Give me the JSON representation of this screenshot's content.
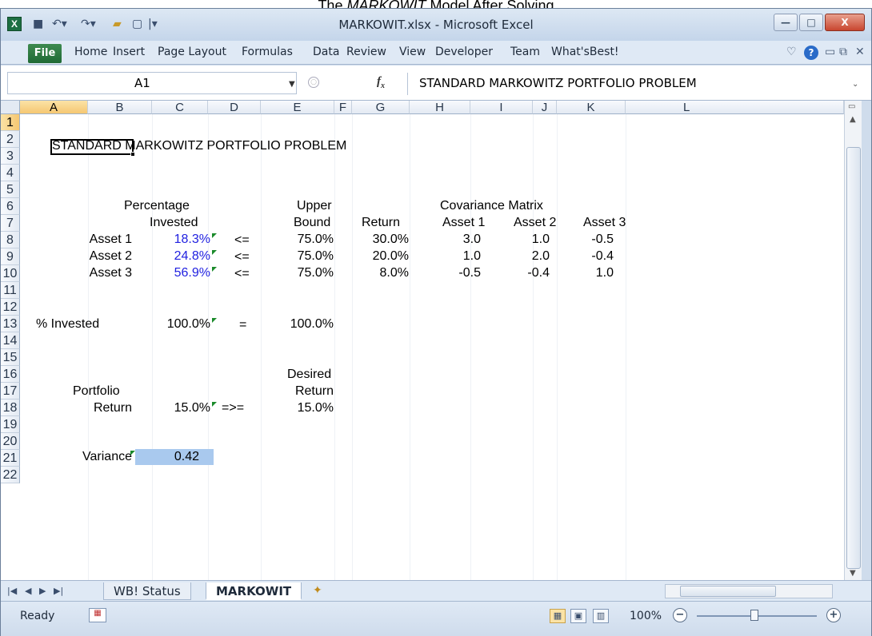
{
  "caption": {
    "prefix": "The ",
    "model": "MARKOWIT",
    "suffix": " Model After Solving"
  },
  "window": {
    "title": "MARKOWIT.xlsx - Microsoft Excel",
    "min": "—",
    "max": "□",
    "close": "X"
  },
  "quick_access": {
    "save": "save-icon",
    "undo": "undo-icon",
    "redo": "redo-icon",
    "open": "open-icon",
    "new": "new-icon",
    "customize": "customize-icon"
  },
  "ribbon": {
    "file": "File",
    "tabs": [
      "Home",
      "Insert",
      "Page Layout",
      "Formulas",
      "Data",
      "Review",
      "View",
      "Developer",
      "Team",
      "What'sBest!"
    ]
  },
  "formula_bar": {
    "name_box": "A1",
    "fx": "fx",
    "content": "STANDARD MARKOWITZ PORTFOLIO PROBLEM"
  },
  "columns": [
    "A",
    "B",
    "C",
    "D",
    "E",
    "F",
    "G",
    "H",
    "I",
    "J",
    "K",
    "L"
  ],
  "rows": [
    "1",
    "2",
    "3",
    "4",
    "5",
    "6",
    "7",
    "8",
    "9",
    "10",
    "11",
    "12",
    "13",
    "14",
    "15",
    "16",
    "17",
    "18",
    "19",
    "20",
    "21",
    "22"
  ],
  "cells": {
    "a1": "STANDARD MARKOWITZ PORTFOLIO PROBLEM",
    "b4": "Percentage",
    "b5": "Invested",
    "d4": "Upper",
    "d5": "Bound",
    "e5": "Return",
    "g4": "Covariance Matrix",
    "g5": "Asset 1",
    "h5": "Asset 2",
    "i5": "Asset 3",
    "a6": "Asset 1",
    "a7": "Asset 2",
    "a8": "Asset 3",
    "b6": "18.3%",
    "b7": "24.8%",
    "b8": "56.9%",
    "c6": "<=",
    "c7": "<=",
    "c8": "<=",
    "d6": "75.0%",
    "d7": "75.0%",
    "d8": "75.0%",
    "e6": "30.0%",
    "e7": "20.0%",
    "e8": "8.0%",
    "g6": "3.0",
    "h6": "1.0",
    "i6": "-0.5",
    "g7": "1.0",
    "h7": "2.0",
    "i7": "-0.4",
    "g8": "-0.5",
    "h8": "-0.4",
    "i8": "1.0",
    "a10": "% Invested",
    "b10": "100.0%",
    "c10": "=",
    "d10": "100.0%",
    "d13": "Desired",
    "a14": "Portfolio",
    "d14": "Return",
    "a15": "Return",
    "b15": "15.0%",
    "c15": "=>=",
    "d15": "15.0%",
    "a16": "Variance",
    "b16": "0.42"
  },
  "sheets": [
    {
      "name": "WB! Status",
      "active": false
    },
    {
      "name": "MARKOWIT",
      "active": true
    }
  ],
  "status": {
    "text": "Ready",
    "zoom": "100%"
  },
  "colors": {
    "solver_values": "#1f1fe0",
    "selected_cell_fill": "#a9c9ee",
    "comment_flag": "#1a8a2a"
  }
}
